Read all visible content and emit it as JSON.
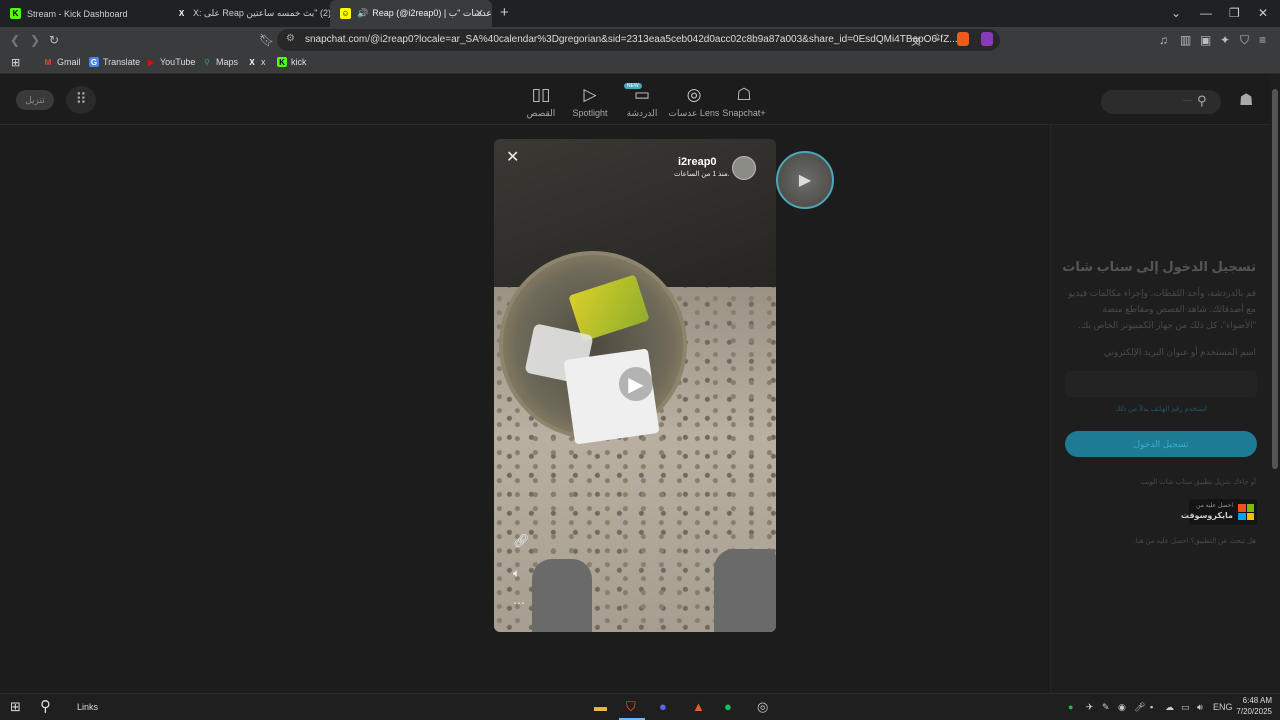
{
  "tabs": [
    {
      "title": "Stream - Kick Dashboard",
      "icon": "kick-icon"
    },
    {
      "title": "X: على Reap ؟ (2) \"بث خمسه ساعتين\"",
      "icon": "x-icon"
    },
    {
      "title": "Reap (@i2reap0) | عدسات \"ب\"",
      "icon": "snapchat-icon",
      "active": true
    }
  ],
  "url": "snapchat.com/@i2reap0?locale=ar_SA%40calendar%3Dgregorian&sid=2313eaa5ceb042d0acc02c8b9a87a003&share_id=0EsdQMi4TBapO6-fZ...",
  "bookmarks": [
    "Gmail",
    "Translate",
    "YouTube",
    "Maps",
    "x",
    "kick"
  ],
  "header": {
    "download_button": "تنزيل",
    "nav": [
      {
        "label": "القصص",
        "icon": "stories-icon"
      },
      {
        "label": "Spotlight",
        "icon": "play-icon"
      },
      {
        "label": "الدردشة",
        "icon": "chat-icon",
        "badge": "NEW"
      },
      {
        "label": "عدسات Lens",
        "icon": "lens-icon"
      },
      {
        "label": "Snapchat+",
        "icon": "ghost-plus-icon"
      }
    ]
  },
  "story": {
    "username": "i2reap0",
    "time": "منذ 1 من الساعات."
  },
  "login": {
    "title": "تسجيل الدخول إلى سناب شات",
    "description": "قم بالدردشة، وأخذ اللقطات، وإجراء مكالمات فيديو مع أصدقائك. شاهد القصص ومقاطع منصة \"الأضواء\"، كل ذلك من جهاز الكمبيوتر الخاص بك.",
    "field_label": "اسم المستخدم أو عنوان البريد الإلكتروني",
    "field_value": "",
    "phone_link": "استخدم رقم الهاتف بدلاً من ذلك",
    "login_button": "تسجيل الدخول",
    "download_text": "أو جاءك بتنزيل تطبيق سناب شات الويب",
    "microsoft_line1": "احصل عليه من",
    "microsoft_line2": "مايكروسوفت",
    "help_text": "هل تبحث عن التطبيق؟ احصل عليه من هنا."
  },
  "taskbar": {
    "links_label": "Links",
    "language": "ENG",
    "time": "6:48 AM",
    "date": "7/20/2025"
  },
  "colors": {
    "accent": "#1d7b93",
    "badge": "#4aa7bd"
  }
}
